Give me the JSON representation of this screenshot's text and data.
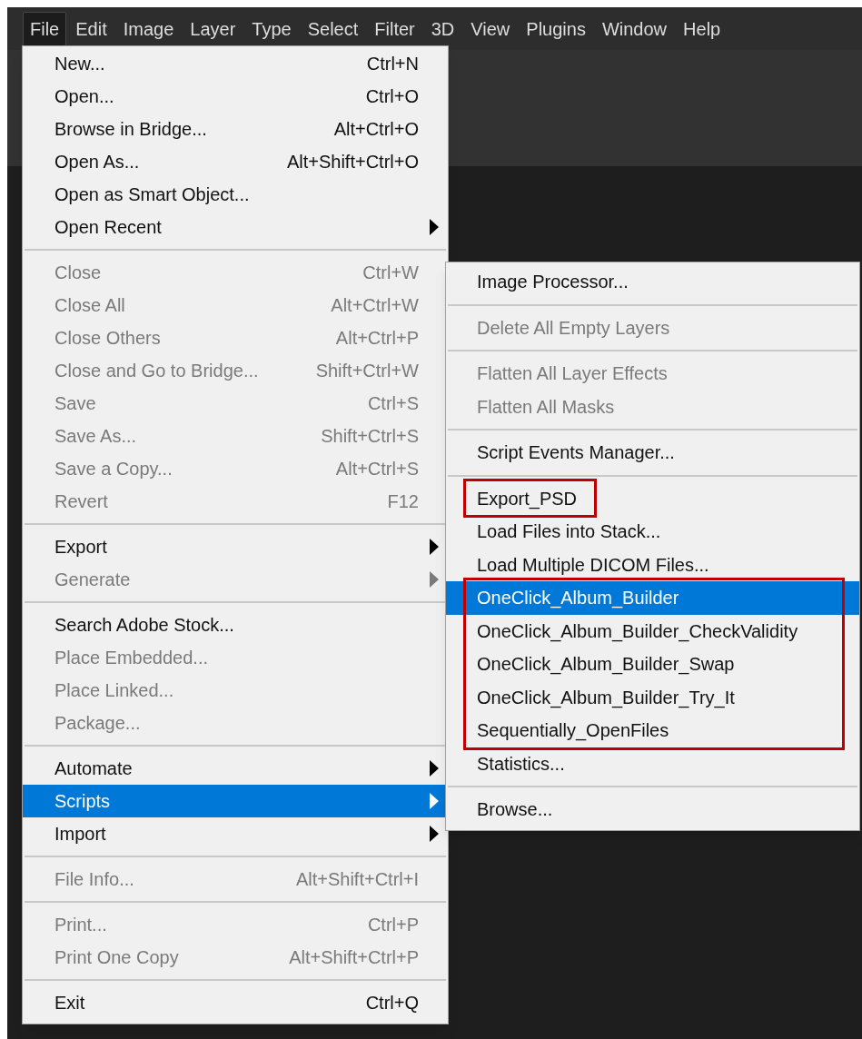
{
  "menu_bar": [
    {
      "label": "File",
      "selected": true
    },
    {
      "label": "Edit",
      "selected": false
    },
    {
      "label": "Image",
      "selected": false
    },
    {
      "label": "Layer",
      "selected": false
    },
    {
      "label": "Type",
      "selected": false
    },
    {
      "label": "Select",
      "selected": false
    },
    {
      "label": "Filter",
      "selected": false
    },
    {
      "label": "3D",
      "selected": false
    },
    {
      "label": "View",
      "selected": false
    },
    {
      "label": "Plugins",
      "selected": false
    },
    {
      "label": "Window",
      "selected": false
    },
    {
      "label": "Help",
      "selected": false
    }
  ],
  "file_menu": {
    "groups": [
      [
        {
          "label": "New...",
          "shortcut": "Ctrl+N",
          "disabled": false,
          "selected": false,
          "has_submenu": false
        },
        {
          "label": "Open...",
          "shortcut": "Ctrl+O",
          "disabled": false,
          "selected": false,
          "has_submenu": false
        },
        {
          "label": "Browse in Bridge...",
          "shortcut": "Alt+Ctrl+O",
          "disabled": false,
          "selected": false,
          "has_submenu": false
        },
        {
          "label": "Open As...",
          "shortcut": "Alt+Shift+Ctrl+O",
          "disabled": false,
          "selected": false,
          "has_submenu": false
        },
        {
          "label": "Open as Smart Object...",
          "disabled": false,
          "selected": false,
          "has_submenu": false
        },
        {
          "label": "Open Recent",
          "disabled": false,
          "selected": false,
          "has_submenu": true
        }
      ],
      [
        {
          "label": "Close",
          "shortcut": "Ctrl+W",
          "disabled": true,
          "selected": false,
          "has_submenu": false
        },
        {
          "label": "Close All",
          "shortcut": "Alt+Ctrl+W",
          "disabled": true,
          "selected": false,
          "has_submenu": false
        },
        {
          "label": "Close Others",
          "shortcut": "Alt+Ctrl+P",
          "disabled": true,
          "selected": false,
          "has_submenu": false
        },
        {
          "label": "Close and Go to Bridge...",
          "shortcut": "Shift+Ctrl+W",
          "disabled": true,
          "selected": false,
          "has_submenu": false
        },
        {
          "label": "Save",
          "shortcut": "Ctrl+S",
          "disabled": true,
          "selected": false,
          "has_submenu": false
        },
        {
          "label": "Save As...",
          "shortcut": "Shift+Ctrl+S",
          "disabled": true,
          "selected": false,
          "has_submenu": false
        },
        {
          "label": "Save a Copy...",
          "shortcut": "Alt+Ctrl+S",
          "disabled": true,
          "selected": false,
          "has_submenu": false
        },
        {
          "label": "Revert",
          "shortcut": "F12",
          "disabled": true,
          "selected": false,
          "has_submenu": false
        }
      ],
      [
        {
          "label": "Export",
          "disabled": false,
          "selected": false,
          "has_submenu": true
        },
        {
          "label": "Generate",
          "disabled": true,
          "selected": false,
          "has_submenu": true
        }
      ],
      [
        {
          "label": "Search Adobe Stock...",
          "disabled": false,
          "selected": false,
          "has_submenu": false
        },
        {
          "label": "Place Embedded...",
          "disabled": true,
          "selected": false,
          "has_submenu": false
        },
        {
          "label": "Place Linked...",
          "disabled": true,
          "selected": false,
          "has_submenu": false
        },
        {
          "label": "Package...",
          "disabled": true,
          "selected": false,
          "has_submenu": false
        }
      ],
      [
        {
          "label": "Automate",
          "disabled": false,
          "selected": false,
          "has_submenu": true
        },
        {
          "label": "Scripts",
          "disabled": false,
          "selected": true,
          "has_submenu": true
        },
        {
          "label": "Import",
          "disabled": false,
          "selected": false,
          "has_submenu": true
        }
      ],
      [
        {
          "label": "File Info...",
          "shortcut": "Alt+Shift+Ctrl+I",
          "disabled": true,
          "selected": false,
          "has_submenu": false
        }
      ],
      [
        {
          "label": "Print...",
          "shortcut": "Ctrl+P",
          "disabled": true,
          "selected": false,
          "has_submenu": false
        },
        {
          "label": "Print One Copy",
          "shortcut": "Alt+Shift+Ctrl+P",
          "disabled": true,
          "selected": false,
          "has_submenu": false
        }
      ],
      [
        {
          "label": "Exit",
          "shortcut": "Ctrl+Q",
          "disabled": false,
          "selected": false,
          "has_submenu": false
        }
      ]
    ]
  },
  "scripts_submenu": {
    "groups": [
      [
        {
          "kind": "item",
          "label": "Image Processor...",
          "disabled": false,
          "selected": false
        }
      ],
      [
        {
          "kind": "item",
          "label": "Delete All Empty Layers",
          "disabled": true,
          "selected": false
        }
      ],
      [
        {
          "kind": "item",
          "label": "Flatten All Layer Effects",
          "disabled": true,
          "selected": false
        },
        {
          "kind": "item",
          "label": "Flatten All Masks",
          "disabled": true,
          "selected": false
        }
      ],
      [
        {
          "kind": "item",
          "label": "Script Events Manager...",
          "disabled": false,
          "selected": false
        }
      ],
      [
        {
          "kind": "label_frame",
          "items": [
            {
              "kind": "item",
              "label": "Export_PSD",
              "disabled": false,
              "selected": false
            }
          ]
        },
        {
          "kind": "item",
          "label": "Load Files into Stack...",
          "disabled": false,
          "selected": false
        },
        {
          "kind": "item",
          "label": "Load Multiple DICOM Files...",
          "disabled": false,
          "selected": false
        },
        {
          "kind": "row_frame",
          "items": [
            {
              "kind": "item",
              "label": "OneClick_Album_Builder",
              "disabled": false,
              "selected": true
            },
            {
              "kind": "item",
              "label": "OneClick_Album_Builder_CheckValidity",
              "disabled": false,
              "selected": false
            },
            {
              "kind": "item",
              "label": "OneClick_Album_Builder_Swap",
              "disabled": false,
              "selected": false
            },
            {
              "kind": "item",
              "label": "OneClick_Album_Builder_Try_It",
              "disabled": false,
              "selected": false
            },
            {
              "kind": "item",
              "label": "Sequentially_OpenFiles",
              "disabled": false,
              "selected": false
            }
          ]
        },
        {
          "kind": "item",
          "label": "Statistics...",
          "disabled": false,
          "selected": false
        }
      ],
      [
        {
          "kind": "item",
          "label": "Browse...",
          "disabled": false,
          "selected": false
        }
      ]
    ]
  }
}
